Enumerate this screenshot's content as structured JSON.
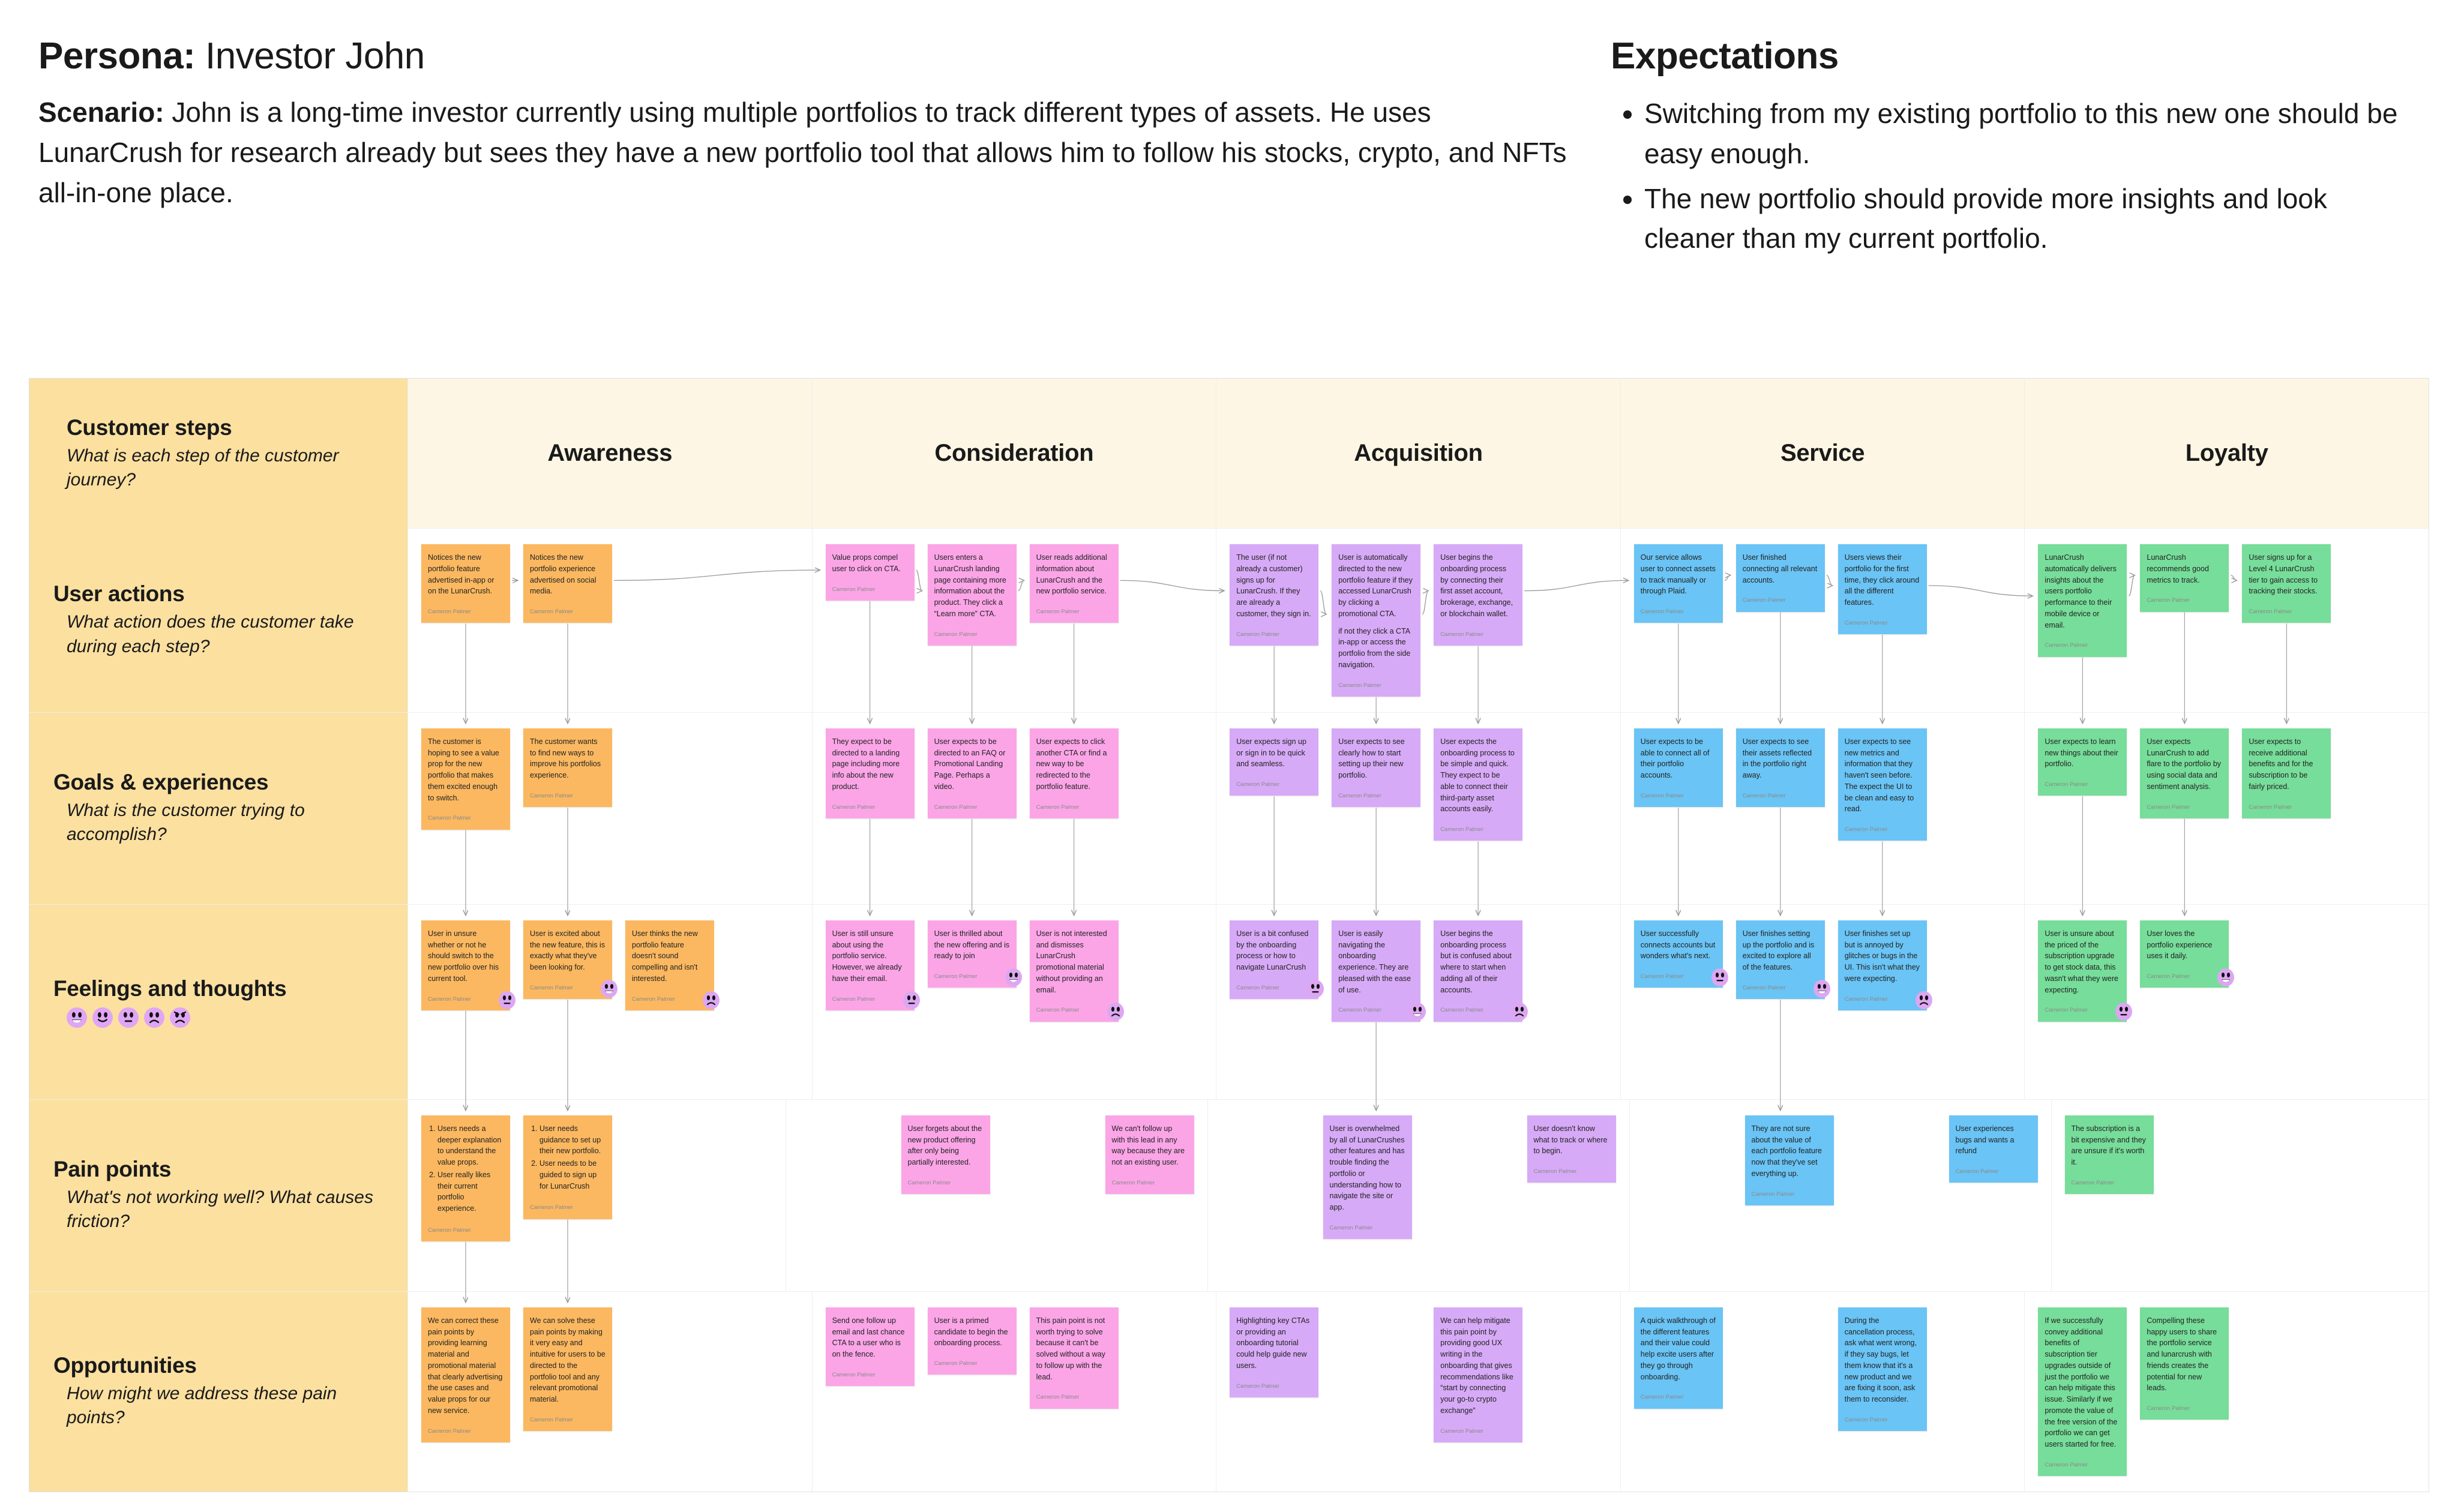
{
  "header": {
    "persona_label": "Persona:",
    "persona_name": " Investor John",
    "scenario_label": "Scenario:",
    "scenario_text": " John is a long-time investor currently using multiple portfolios to track different types of assets. He uses LunarCrush for research already but sees they have a new portfolio tool that allows him to follow his stocks, crypto, and NFTs all-in-one place.",
    "expectations_title": "Expectations",
    "expectations": [
      "Switching from my existing portfolio to this new one should be easy enough.",
      "The new portfolio should provide more insights and look cleaner than my current portfolio."
    ]
  },
  "colors": {
    "row_label_bg": "#fbe0a0",
    "header_cell_bg": "#fdf6e4",
    "orange": "#fbb860",
    "pink": "#fba5e7",
    "purple": "#d7aaf7",
    "blue": "#6ac4f5",
    "green": "#77dd9a",
    "face_badge": "#dda6f2"
  },
  "author": "Cameron Palmer",
  "stages": [
    "Awareness",
    "Consideration",
    "Acquisition",
    "Service",
    "Loyalty"
  ],
  "rows": [
    {
      "title": "Customer steps",
      "question": "What is each step of the customer journey?"
    },
    {
      "title": "User actions",
      "question": "What action does the customer take during each step?"
    },
    {
      "title": "Goals & experiences",
      "question": "What is the customer trying to accomplish?"
    },
    {
      "title": "Feelings and thoughts",
      "question": ""
    },
    {
      "title": "Pain points",
      "question": "What's not working well? What causes friction?"
    },
    {
      "title": "Opportunities",
      "question": "How might we address these pain points?"
    }
  ],
  "feelings_scale": [
    "grin",
    "smile",
    "neutral",
    "frown",
    "angry"
  ],
  "user_actions": {
    "awareness": [
      "Notices the new portfolio feature advertised in-app or on the LunarCrush.",
      "Notices the new portfolio experience advertised on social media."
    ],
    "consideration": [
      "Value props compel user to click on CTA.",
      "Users enters a LunarCrush landing page containing more information about the product. They click a “Learn more” CTA.",
      "User reads additional information about LunarCrush and the new portfolio service."
    ],
    "acquisition": [
      "The user (if not already a customer) signs up for LunarCrush. If they are already a customer, they sign in.",
      "User is automatically directed to the new portfolio feature if they accessed LunarCrush by clicking a promotional CTA.\n\nif not they click a CTA in-app or access the portfolio from the side navigation.",
      "User begins the onboarding process by connecting their first asset account, brokerage, exchange, or blockchain wallet."
    ],
    "service": [
      "Our service allows user to connect assets to track manually or through Plaid.",
      "User finished connecting all relevant accounts.",
      "Users views their portfolio for the first time, they click around all the different features."
    ],
    "loyalty": [
      "LunarCrush automatically delivers insights about the users portfolio performance to their mobile device or email.",
      "LunarCrush recommends good metrics to track.",
      "User signs up for a Level 4 LunarCrush tier to gain access to tracking their stocks."
    ]
  },
  "goals": {
    "awareness": [
      "The customer is hoping to see a value prop for the new portfolio that makes them excited enough to switch.",
      "The customer wants to find new ways to improve his portfolios experience."
    ],
    "consideration": [
      "They expect to be directed to a landing page including more info about the new product.",
      "User expects to be directed to an FAQ or Promotional Landing Page. Perhaps a video.",
      "User expects to click another CTA or find a new way to be redirected to the portfolio feature."
    ],
    "acquisition": [
      "User expects sign up or sign in to be quick and seamless.",
      "User expects to see clearly how to start setting up their new portfolio.",
      "User expects the onboarding process to be simple and quick. They expect to be able to connect their third-party asset accounts easily."
    ],
    "service": [
      "User expects to be able to connect all of their portfolio accounts.",
      "User expects to see their assets reflected in the portfolio right away.",
      "User expects to see new metrics and information that they haven't seen before. The expect the UI to be clean and easy to read."
    ],
    "loyalty": [
      "User expects to learn new things about their portfolio.",
      "User expects LunarCrush to add flare to the portfolio by using social data and sentiment analysis.",
      "User expects to receive additional benefits and for the subscription to be fairly priced."
    ]
  },
  "feelings": {
    "awareness": [
      {
        "text": "User in unsure whether or not he should switch to the new portfolio over his current tool.",
        "face": "neutral"
      },
      {
        "text": "User is excited about the new feature, this is exactly what they've been looking for.",
        "face": "grin"
      },
      {
        "text": "User thinks the new portfolio feature doesn't sound compelling and isn't interested.",
        "face": "frown"
      }
    ],
    "consideration": [
      {
        "text": "User is still unsure about using the portfolio service. However, we already have their email.",
        "face": "neutral"
      },
      {
        "text": "User is thrilled about the new offering and is ready to join",
        "face": "grin"
      },
      {
        "text": "User is not interested and dismisses LunarCrush promotional material without providing an email.",
        "face": "frown"
      }
    ],
    "acquisition": [
      {
        "text": "User is a bit confused by the onboarding process or how to navigate LunarCrush",
        "face": "neutral"
      },
      {
        "text": "User is easily navigating the onboarding experience. They are pleased with the ease of use.",
        "face": "grin"
      },
      {
        "text": "User begins the onboarding process but is confused about where to start when adding all of their accounts.",
        "face": "frown"
      }
    ],
    "service": [
      {
        "text": "User successfully connects accounts but wonders what's next.",
        "face": "neutral"
      },
      {
        "text": "User finishes setting up the portfolio and is excited to explore all of the features.",
        "face": "grin"
      },
      {
        "text": "User finishes set up but is annoyed by glitches or bugs in the UI. This isn't what they were expecting.",
        "face": "frown"
      }
    ],
    "loyalty": [
      {
        "text": "User is unsure about the priced of the subscription upgrade to get stock data, this wasn't what they were expecting.",
        "face": "neutral"
      },
      {
        "text": "User loves the portfolio experience uses it daily.",
        "face": "grin"
      }
    ]
  },
  "pain_points": {
    "awareness": [
      {
        "list": [
          "Users needs a deeper explanation to understand the value props.",
          "User really likes their current portfolio experience."
        ]
      },
      {
        "list": [
          "User needs guidance to set up their new portfolio.",
          "User needs to be guided to sign up for LunarCrush"
        ]
      }
    ],
    "consideration": [
      {
        "text": "User forgets about the new product offering after only being partially interested."
      },
      {
        "text": "We can't follow up with this lead in any way because they are not an existing user."
      }
    ],
    "acquisition": [
      {
        "text": "User is overwhelmed by all of LunarCrushes other features and has trouble finding the portfolio or understanding how to navigate the site or app."
      },
      {
        "text": "User doesn't know what to track or where to begin."
      }
    ],
    "service": [
      {
        "text": "They are not sure about the value of each portfolio feature now that they've set everything up."
      },
      {
        "text": "User experiences bugs and wants a refund"
      }
    ],
    "loyalty": [
      {
        "text": "The subscription is a bit expensive and they are unsure if it's worth it."
      }
    ]
  },
  "opportunities": {
    "awareness": [
      "We can correct these pain points by providing learning material and promotional material that clearly advertising the use cases and value props for our new service.",
      "We can solve these pain points by making it very easy and intuitive for users to be directed to the portfolio tool and any relevant promotional material."
    ],
    "consideration": [
      "Send one follow up email and last chance CTA to a user who is on the fence.",
      "User is a primed candidate to begin the onboarding process.",
      "This pain point is not worth trying to solve because it can't be solved without a way to follow up with the lead."
    ],
    "acquisition": [
      "Highlighting key CTAs or providing an onboarding tutorial could help guide new users.",
      "We can help mitigate this pain point by providing good UX writing in the onboarding that gives recommendations like “start by connecting your go-to crypto exchange”"
    ],
    "service": [
      "A quick walkthrough of the different features and their value could help excite users after they go through onboarding.",
      "During the cancellation process, ask what went wrong, if they say bugs, let them know that it's a new product and we are fixing it soon, ask them to reconsider."
    ],
    "loyalty": [
      "If we successfully convey additional benefits of subscription tier upgrades outside of just the portfolio we can help mitigate this issue. Similarly if we promote the value of the free version of the portfolio we can get users started for free.",
      "Compelling these happy users to share the portfolio service and lunarcrush with friends creates the potential for new leads."
    ]
  }
}
